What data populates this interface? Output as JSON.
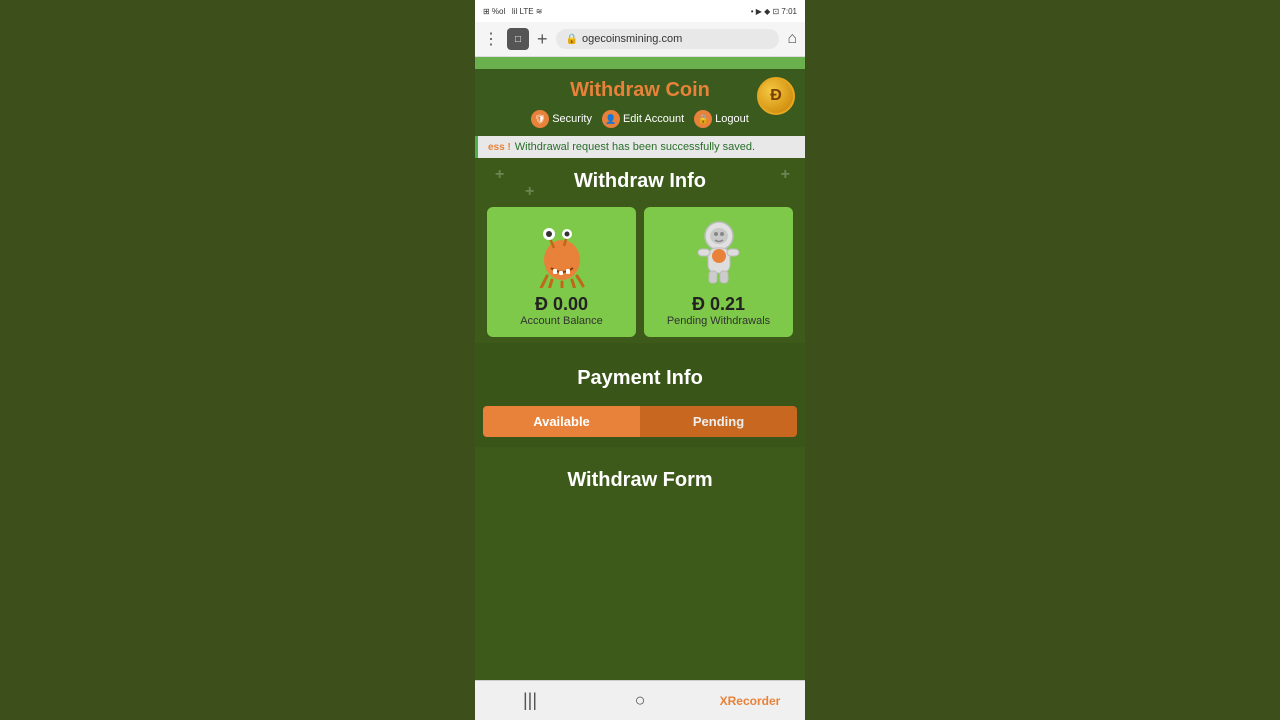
{
  "status_bar": {
    "left_text": "⊞ %ol  ¥.  lil  LTE  ≋",
    "right_text": "▶ ✦ 🔒 ⊡  7:01"
  },
  "browser": {
    "url": "ogecoinsmining.com",
    "tab_icon": "□"
  },
  "header": {
    "title": "Withdraw Coin",
    "nav": {
      "security_label": "Security",
      "edit_account_label": "Edit Account",
      "logout_label": "Logout"
    },
    "coin_symbol": "Ð"
  },
  "success_banner": {
    "prefix": "ess !",
    "message": "Withdrawal request has been successfully saved."
  },
  "withdraw_info": {
    "section_title": "Withdraw Info",
    "account_balance_card": {
      "amount": "Ð 0.00",
      "label": "Account Balance"
    },
    "pending_withdrawals_card": {
      "amount": "Ð 0.21",
      "label": "Pending Withdrawals"
    }
  },
  "payment_info": {
    "section_title": "Payment Info",
    "tabs": {
      "available_label": "Available",
      "pending_label": "Pending"
    }
  },
  "withdraw_form": {
    "section_title": "Withdraw Form"
  },
  "bottom_nav": {
    "menu_icon": "|||",
    "home_icon": "○",
    "recorder_label": "XRecorder"
  }
}
